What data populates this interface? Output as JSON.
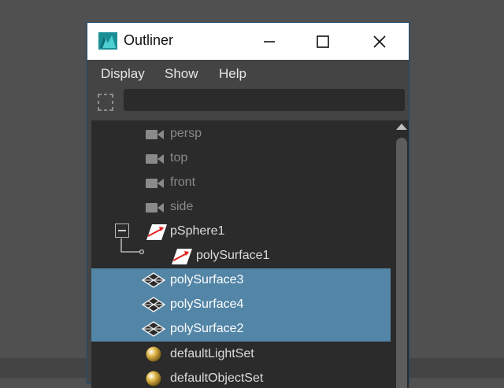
{
  "window": {
    "title": "Outliner",
    "accent": "#1f4a6e"
  },
  "menu": {
    "items": [
      {
        "label": "Display"
      },
      {
        "label": "Show"
      },
      {
        "label": "Help"
      }
    ]
  },
  "search": {
    "value": "",
    "placeholder": ""
  },
  "tree": {
    "selection_color": "#5285a6",
    "items": [
      {
        "label": "persp",
        "icon": "camera-icon",
        "dim": true,
        "selected": false
      },
      {
        "label": "top",
        "icon": "camera-icon",
        "dim": true,
        "selected": false
      },
      {
        "label": "front",
        "icon": "camera-icon",
        "dim": true,
        "selected": false
      },
      {
        "label": "side",
        "icon": "camera-icon",
        "dim": true,
        "selected": false
      },
      {
        "label": "pSphere1",
        "icon": "transform-icon",
        "dim": false,
        "selected": false,
        "expanded": true
      },
      {
        "label": "polySurface1",
        "icon": "transform-icon",
        "dim": false,
        "selected": false
      },
      {
        "label": "polySurface3",
        "icon": "mesh-icon",
        "dim": false,
        "selected": true
      },
      {
        "label": "polySurface4",
        "icon": "mesh-icon",
        "dim": false,
        "selected": true
      },
      {
        "label": "polySurface2",
        "icon": "mesh-icon",
        "dim": false,
        "selected": true
      },
      {
        "label": "defaultLightSet",
        "icon": "set-icon",
        "dim": false,
        "selected": false
      },
      {
        "label": "defaultObjectSet",
        "icon": "set-icon",
        "dim": false,
        "selected": false
      }
    ]
  }
}
